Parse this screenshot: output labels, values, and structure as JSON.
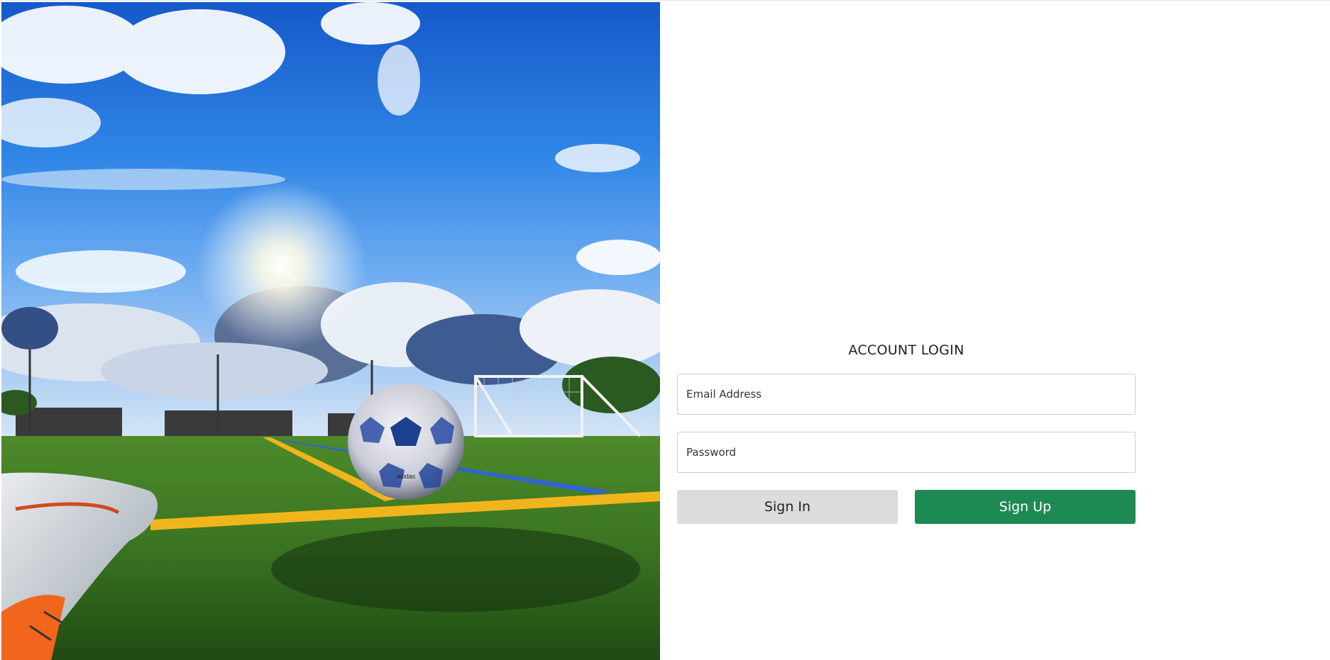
{
  "hero": {
    "image_name": "soccer-field-hero-image",
    "colors": {
      "sky_top": "#1f6fd8",
      "sky_mid": "#3b91ea",
      "grass": "#2f6b1f",
      "line_yellow": "#f1b51c",
      "line_blue": "#2f63d6"
    }
  },
  "login": {
    "title": "ACCOUNT LOGIN",
    "email_placeholder": "Email Address",
    "password_placeholder": "Password",
    "sign_in_label": "Sign In",
    "sign_up_label": "Sign Up",
    "colors": {
      "sign_in_bg": "#dcdcdc",
      "sign_up_bg": "#1e8a53"
    }
  }
}
